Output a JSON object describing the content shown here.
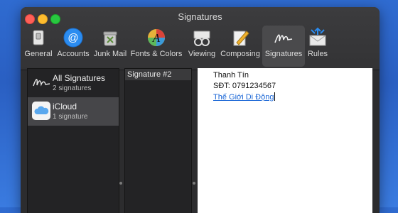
{
  "window": {
    "title": "Signatures"
  },
  "toolbar": {
    "items": [
      {
        "label": "General",
        "icon": "general-switch-icon"
      },
      {
        "label": "Accounts",
        "icon": "at-sign-icon"
      },
      {
        "label": "Junk Mail",
        "icon": "junk-mail-trash-icon"
      },
      {
        "label": "Fonts & Colors",
        "icon": "font-colors-icon"
      },
      {
        "label": "Viewing",
        "icon": "glasses-icon"
      },
      {
        "label": "Composing",
        "icon": "pencil-paper-icon"
      },
      {
        "label": "Signatures",
        "icon": "signature-icon"
      },
      {
        "label": "Rules",
        "icon": "rules-envelope-icon"
      }
    ],
    "active": "Signatures"
  },
  "accounts": [
    {
      "name": "All Signatures",
      "sub": "2 signatures",
      "icon": "signature-icon"
    },
    {
      "name": "iCloud",
      "sub": "1 signature",
      "icon": "icloud-icon"
    }
  ],
  "signatures": [
    {
      "name": "Signature #2"
    }
  ],
  "editor": {
    "line1": "Thanh Tín",
    "line2": "SĐT: 0791234567",
    "link": "Thế Giới Di Động"
  },
  "colors": {
    "link": "#1a66d6",
    "accent_blue": "#2f6bd0",
    "selected_row": "#464649"
  }
}
